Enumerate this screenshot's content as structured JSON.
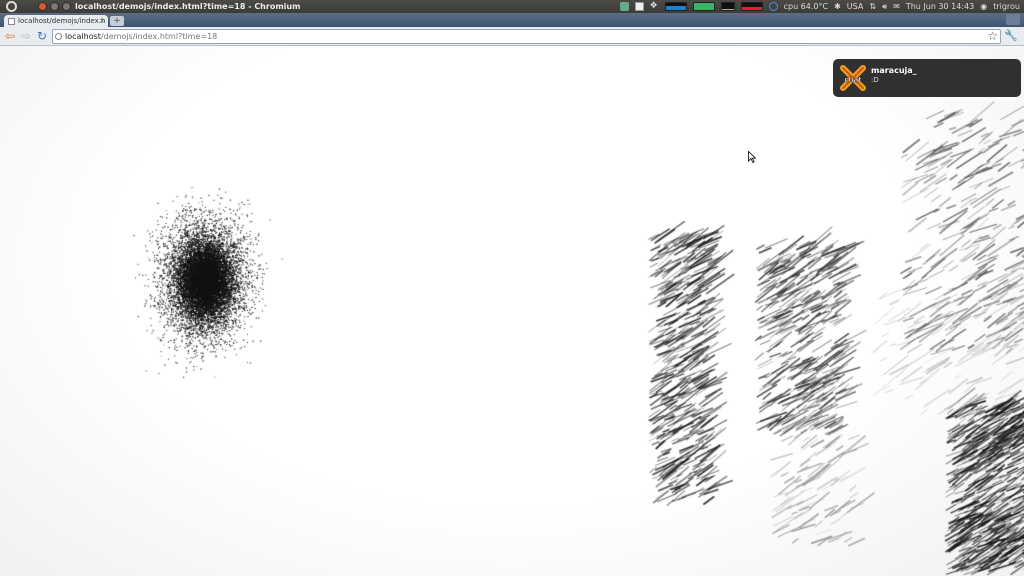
{
  "top_panel": {
    "window_title": "localhost/demojs/index.html?time=18 - Chromium",
    "cpu_temp": "cpu 64.0°C",
    "keyboard_layout": "USA",
    "datetime": "Thu Jun 30 14:43",
    "username": "trigrou"
  },
  "tab": {
    "title": "localhost/demojs/index.h",
    "close_glyph": "×",
    "new_tab_glyph": "+"
  },
  "toolbar": {
    "back_glyph": "⇦",
    "forward_glyph": "⇨",
    "reload_glyph": "↻",
    "url_host": "localhost",
    "url_path": "/demojs/index.html?time=18",
    "star_glyph": "☆",
    "wrench_glyph": "🔧"
  },
  "notification": {
    "title": "maracuja_",
    "body": ":D",
    "icon": "xchat-icon"
  },
  "icons": {
    "ubuntu": "ubuntu-logo-icon",
    "indicators": [
      "network-icon",
      "checkbox-icon",
      "dropbox-icon",
      "bluetooth-icon",
      "network-updown-icon",
      "volume-icon",
      "mail-icon",
      "user-icon"
    ]
  },
  "colors": {
    "panel_bg": "#3c3b37",
    "tab_strip": "#4c6279",
    "toolbar": "#e8ecf1",
    "notification_bg": "#232323",
    "xchat_orange": "#f0a020"
  }
}
